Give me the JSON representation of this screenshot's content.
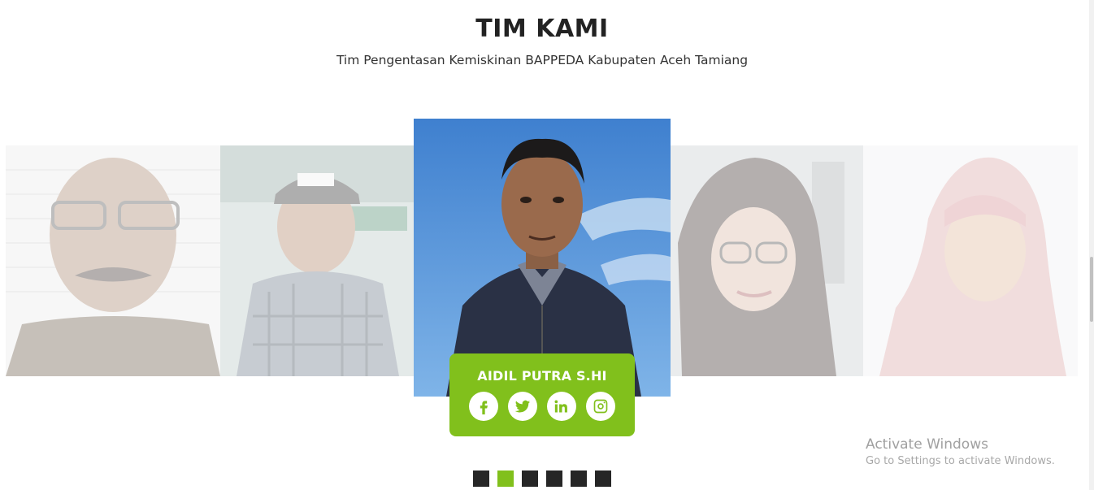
{
  "section": {
    "title": "TIM KAMI",
    "subtitle": "Tim Pengentasan Kemiskinan BAPPEDA Kabupaten Aceh Tamiang"
  },
  "carousel": {
    "active_member": {
      "name": "AIDIL PUTRA S.HI",
      "socials": [
        "facebook-icon",
        "twitter-icon",
        "linkedin-icon",
        "instagram-icon"
      ]
    },
    "pagination": {
      "count": 6,
      "active_index": 1
    }
  },
  "colors": {
    "accent": "#81c01c",
    "dot": "#262626"
  },
  "watermark": {
    "title": "Activate Windows",
    "subtitle": "Go to Settings to activate Windows."
  }
}
